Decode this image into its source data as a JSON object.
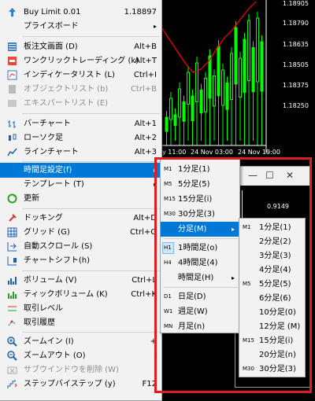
{
  "chart": {
    "prices": [
      "1.18905",
      "1.18790",
      "1.18635",
      "1.18505",
      "1.18375",
      "1.18250",
      "0.9149"
    ],
    "times": [
      "y 11:00",
      "24 Nov 03:00",
      "24 Nov 19:00"
    ]
  },
  "child_window": {
    "minimize": "—",
    "maximize": "☐",
    "close": "✕"
  },
  "main_menu": {
    "items": [
      {
        "label": "Buy Limit 0.01",
        "shortcut": "1.18897",
        "icon": "buy-limit-icon"
      },
      {
        "label": "プライスボード",
        "arrow": "▸"
      },
      {
        "label": "板注文画面 (D)",
        "shortcut": "Alt+B",
        "icon": "order-book-icon"
      },
      {
        "label": "ワンクリックトレーディング (k)",
        "shortcut": "Alt+T",
        "icon": "one-click-trading-icon"
      },
      {
        "label": "インディケータリスト (L)",
        "shortcut": "Ctrl+I",
        "icon": "indicator-list-icon"
      },
      {
        "label": "オブジェクトリスト (b)",
        "shortcut": "Ctrl+B",
        "icon": "object-list-icon",
        "disabled": true
      },
      {
        "label": "エキスパートリスト (E)",
        "icon": "expert-list-icon",
        "disabled": true
      },
      {
        "label": "バーチャート",
        "shortcut": "Alt+1",
        "icon": "bar-chart-icon"
      },
      {
        "label": "ローソク足",
        "shortcut": "Alt+2",
        "icon": "candlestick-icon"
      },
      {
        "label": "ラインチャート",
        "shortcut": "Alt+3",
        "icon": "line-chart-icon"
      },
      {
        "label": "時間足設定(f)",
        "arrow": "▸",
        "highlighted": true
      },
      {
        "label": "テンプレート (T)",
        "arrow": "▸"
      },
      {
        "label": "更新",
        "icon": "refresh-icon"
      },
      {
        "label": "ドッキング",
        "shortcut": "Alt+D",
        "icon": "docking-icon"
      },
      {
        "label": "グリッド (G)",
        "shortcut": "Ctrl+G",
        "icon": "grid-icon"
      },
      {
        "label": "自動スクロール (S)",
        "icon": "auto-scroll-icon"
      },
      {
        "label": "チャートシフト(h)",
        "icon": "chart-shift-icon"
      },
      {
        "label": "ボリューム (V)",
        "shortcut": "Ctrl+L",
        "icon": "volume-icon"
      },
      {
        "label": "ティックボリューム (K)",
        "shortcut": "Ctrl+K",
        "icon": "tick-volume-icon"
      },
      {
        "label": "取引レベル",
        "icon": "trade-levels-icon"
      },
      {
        "label": "取引履歴",
        "icon": "trade-history-icon"
      },
      {
        "label": "ズームイン (I)",
        "shortcut": "+",
        "icon": "zoom-in-icon"
      },
      {
        "label": "ズームアウト (O)",
        "shortcut": "-",
        "icon": "zoom-out-icon"
      },
      {
        "label": "サブウインドウを削除 (W)",
        "icon": "delete-subwindow-icon",
        "disabled": true
      },
      {
        "label": "ステップバイステップ (y)",
        "shortcut": "F12",
        "icon": "step-by-step-icon"
      }
    ]
  },
  "timeframe_menu": {
    "items": [
      {
        "code": "M1",
        "label": "1分足(1)"
      },
      {
        "code": "M5",
        "label": "5分足(5)"
      },
      {
        "code": "M15",
        "label": "15分足(i)"
      },
      {
        "code": "M30",
        "label": "30分足(3)"
      },
      {
        "label": "分足(M)",
        "arrow": "▸",
        "highlighted": true
      },
      {
        "code": "H1",
        "label": "1時間足(o)",
        "checked": true
      },
      {
        "code": "H4",
        "label": "4時間足(4)"
      },
      {
        "label": "時間足(H)",
        "arrow": "▸"
      },
      {
        "code": "D1",
        "label": "日足(D)"
      },
      {
        "code": "W1",
        "label": "週足(W)"
      },
      {
        "code": "MN",
        "label": "月足(n)"
      }
    ]
  },
  "minute_menu": {
    "items": [
      {
        "code": "M1",
        "label": "1分足(1)"
      },
      {
        "code": "",
        "label": "2分足(2)"
      },
      {
        "code": "",
        "label": "3分足(3)"
      },
      {
        "code": "",
        "label": "4分足(4)"
      },
      {
        "code": "M5",
        "label": "5分足(5)"
      },
      {
        "code": "",
        "label": "6分足(6)"
      },
      {
        "code": "",
        "label": "10分足(0)"
      },
      {
        "code": "",
        "label": "12分足 (M)"
      },
      {
        "code": "M15",
        "label": "15分足(i)"
      },
      {
        "code": "",
        "label": "20分足(n)"
      },
      {
        "code": "M30",
        "label": "30分足(3)"
      }
    ]
  },
  "colors": {
    "highlight": "#0078d7",
    "frame": "#e11b22",
    "candle": "#00ff00",
    "ma_line": "#ff0000"
  }
}
